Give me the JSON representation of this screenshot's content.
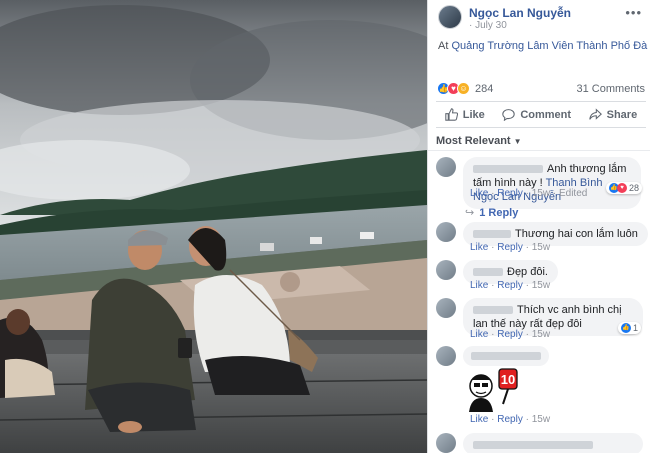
{
  "post": {
    "author": "Ngọc Lan Nguyễn",
    "date": "July 30",
    "location_prefix": "At",
    "location": "Quảng Trường Lâm Viên Thành Phố Đà Lạt",
    "reaction_count": "284",
    "comment_count": "31 Comments"
  },
  "actions": {
    "like": "Like",
    "comment": "Comment",
    "share": "Share"
  },
  "filter": {
    "label": "Most Relevant"
  },
  "comments": [
    {
      "text": "Anh thương lắm tấm hình này !",
      "tag": "Thanh Bình Ngọc Lan Nguyễn",
      "like": "Like",
      "reply": "Reply",
      "time": "15w",
      "edited": "Edited",
      "reactions": "28",
      "replies": "1 Reply"
    },
    {
      "text": "Thương hai con lắm luôn",
      "like": "Like",
      "reply": "Reply",
      "time": "15w"
    },
    {
      "text": "Đẹp đôi.",
      "like": "Like",
      "reply": "Reply",
      "time": "15w"
    },
    {
      "text": "Thích vc anh bình chị lan thế này rất đẹp đôi",
      "like": "Like",
      "reply": "Reply",
      "time": "15w",
      "reactions": "1"
    },
    {
      "sticker_text": "10",
      "like": "Like",
      "reply": "Reply",
      "time": "15w"
    }
  ],
  "icons": {
    "like": "thumbs-up-icon",
    "comment": "speech-bubble-icon",
    "share": "share-arrow-icon",
    "more": "more-dots-icon",
    "dropdown": "chevron-down-icon"
  },
  "colors": {
    "link": "#365899",
    "action_blue": "#4267b2",
    "like_blue": "#1877f2",
    "love_red": "#f33e58",
    "haha_yellow": "#f7b125"
  }
}
